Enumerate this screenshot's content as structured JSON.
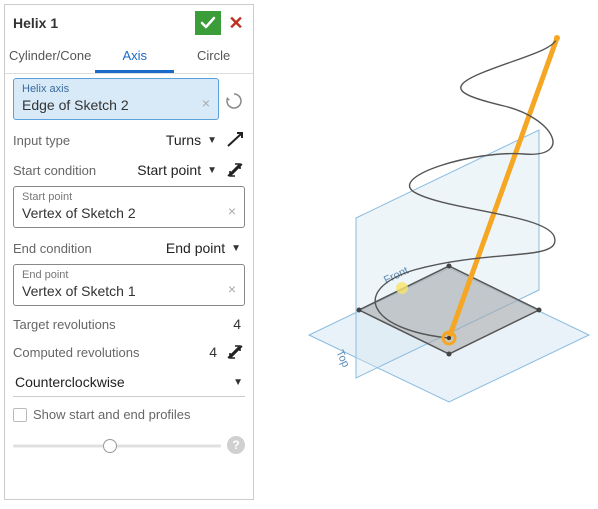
{
  "header": {
    "title": "Helix 1"
  },
  "tabs": [
    {
      "label": "Cylinder/Cone",
      "active": false
    },
    {
      "label": "Axis",
      "active": true
    },
    {
      "label": "Circle",
      "active": false
    }
  ],
  "helix_axis": {
    "label": "Helix axis",
    "value": "Edge of Sketch 2"
  },
  "input_type": {
    "label": "Input type",
    "value": "Turns"
  },
  "start_condition": {
    "label": "Start condition",
    "value": "Start point"
  },
  "start_point": {
    "label": "Start point",
    "value": "Vertex of Sketch 2"
  },
  "end_condition": {
    "label": "End condition",
    "value": "End point"
  },
  "end_point": {
    "label": "End point",
    "value": "Vertex of Sketch 1"
  },
  "target_rev": {
    "label": "Target revolutions",
    "value": "4"
  },
  "computed_rev": {
    "label": "Computed revolutions",
    "value": "4"
  },
  "direction": {
    "value": "Counterclockwise"
  },
  "show_profiles": {
    "label": "Show start and end profiles",
    "checked": false
  },
  "viewport": {
    "plane_front": "Front",
    "plane_top": "Top"
  },
  "slider": {
    "position": 42
  }
}
